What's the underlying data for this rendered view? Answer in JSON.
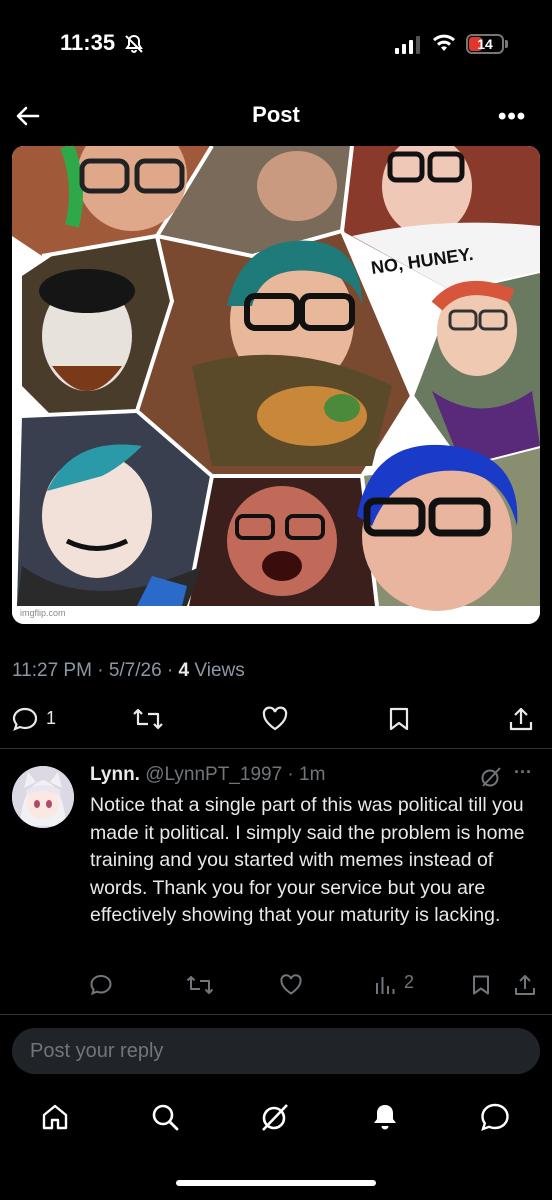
{
  "status_bar": {
    "time": "11:35",
    "battery": "14"
  },
  "header": {
    "title": "Post"
  },
  "image": {
    "watermark": "imgflip.com",
    "shirt_text": "NO, HUNEY."
  },
  "post_meta": {
    "time": "11:27 PM",
    "date": "5/7/26",
    "views_count": "4",
    "views_label": "Views"
  },
  "post_actions": {
    "reply_count": "1"
  },
  "reply": {
    "name": "Lynn.",
    "handle": "@LynnPT_1997",
    "age": "1m",
    "text": "Notice that a single part of this was political till you made it political. I simply said the problem is home training and you started with memes instead of words. Thank you for your service but you are effectively showing that your maturity is lacking.",
    "views": "2"
  },
  "composer": {
    "placeholder": "Post your reply"
  },
  "colors": {
    "background": "#000000",
    "text": "#e7e9ea",
    "muted": "#71767b",
    "battery_low": "#e0362c"
  }
}
